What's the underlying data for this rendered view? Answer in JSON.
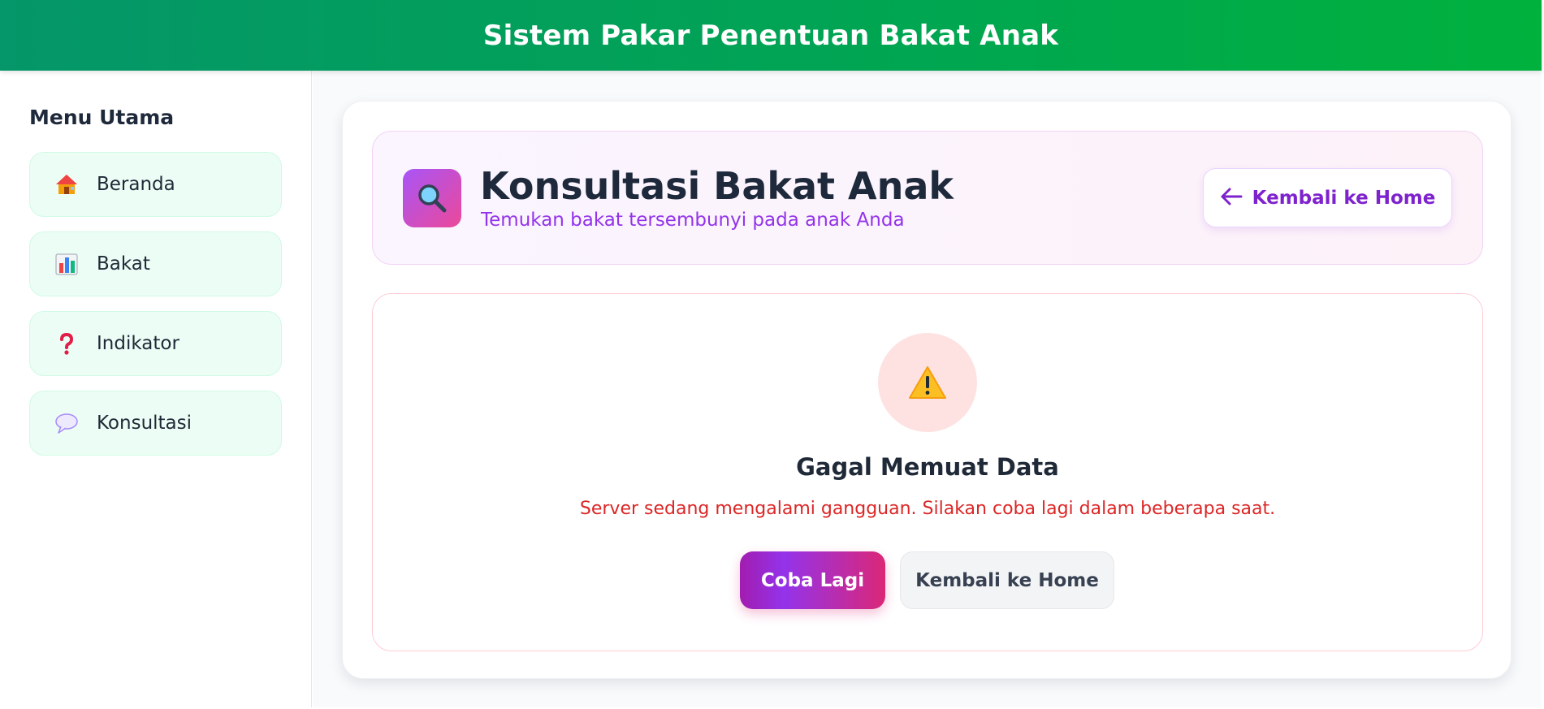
{
  "header": {
    "title": "Sistem Pakar Penentuan Bakat Anak"
  },
  "sidebar": {
    "title": "Menu Utama",
    "items": [
      {
        "label": "Beranda",
        "icon": "house-icon"
      },
      {
        "label": "Bakat",
        "icon": "bar-chart-icon"
      },
      {
        "label": "Indikator",
        "icon": "question-mark-icon"
      },
      {
        "label": "Konsultasi",
        "icon": "speech-bubble-icon"
      }
    ]
  },
  "page": {
    "title": "Konsultasi Bakat Anak",
    "subtitle": "Temukan bakat tersembunyi pada anak Anda",
    "back_button_label": "Kembali ke Home",
    "icon": "magnifier-icon"
  },
  "error": {
    "icon": "warning-icon",
    "title": "Gagal Memuat Data",
    "message": "Server sedang mengalami gangguan. Silakan coba lagi dalam beberapa saat.",
    "retry_label": "Coba Lagi",
    "home_label": "Kembali ke Home"
  },
  "colors": {
    "header_green": "#00a651",
    "accent_purple": "#9333ea",
    "accent_pink": "#db2777",
    "error_red": "#dc2626",
    "sidebar_item_bg": "#ecfdf5"
  }
}
